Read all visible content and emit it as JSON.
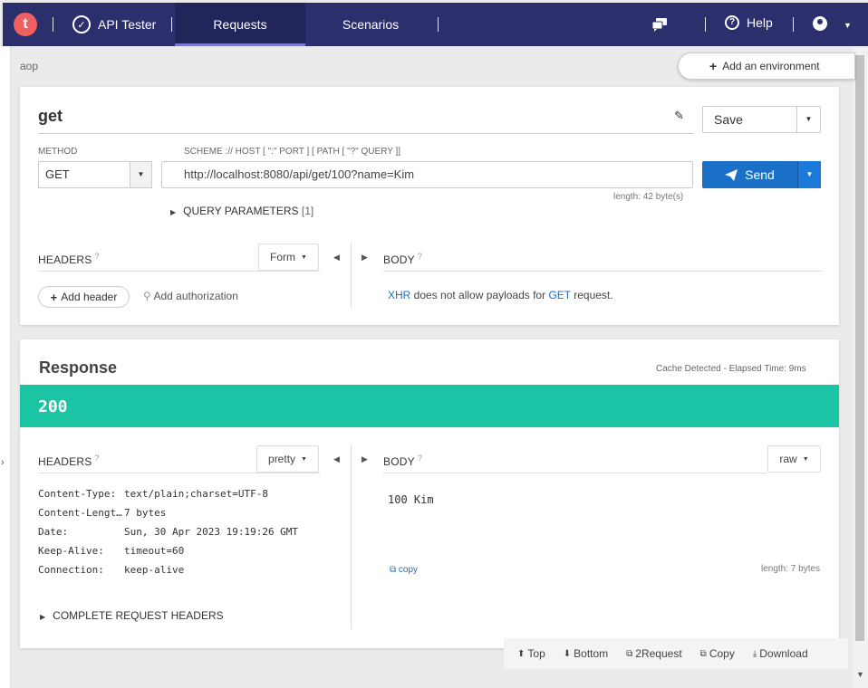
{
  "nav": {
    "logo_letter": "t",
    "brand": "API Tester",
    "tabs": [
      "Requests",
      "Scenarios"
    ],
    "help": "Help"
  },
  "breadcrumb": "aop",
  "env_button": "Add an environment",
  "request": {
    "name": "get",
    "save_label": "Save",
    "method_label": "METHOD",
    "method": "GET",
    "url_label": "SCHEME :// HOST [ \":\" PORT ] [ PATH [ \"?\" QUERY ]]",
    "url": "http://localhost:8080/api/get/100?name=Kim",
    "send_label": "Send",
    "url_length": "length: 42 byte(s)",
    "query_params": "QUERY PARAMETERS",
    "query_params_count": "[1]",
    "headers_label": "HEADERS",
    "form_label": "Form",
    "body_label": "BODY",
    "add_header": "Add header",
    "add_authorization": "Add authorization",
    "body_msg": {
      "xhr": "XHR",
      "middle": " does not allow payloads for ",
      "get": "GET",
      "end": " request."
    }
  },
  "response": {
    "title": "Response",
    "meta": "Cache Detected - Elapsed Time: 9ms",
    "status": "200",
    "headers_label": "HEADERS",
    "pretty_label": "pretty",
    "body_label": "BODY",
    "raw_label": "raw",
    "headers": [
      {
        "key": "Content-Type:",
        "value": "text/plain;charset=UTF-8"
      },
      {
        "key": "Content-Lengt…",
        "value": "7 bytes"
      },
      {
        "key": "Date:",
        "value": "Sun, 30 Apr 2023 19:19:26 GMT"
      },
      {
        "key": "Keep-Alive:",
        "value": "timeout=60"
      },
      {
        "key": "Connection:",
        "value": "keep-alive"
      }
    ],
    "body": "100 Kim",
    "copy": "copy",
    "length": "length: 7 bytes",
    "complete_headers": "COMPLETE REQUEST HEADERS"
  },
  "bottom_bar": [
    "Top",
    "Bottom",
    "2Request",
    "Copy",
    "Download"
  ],
  "colors": {
    "navbar": "#2b2f6b",
    "status_ok": "#1cc4a6",
    "send": "#1a6fc7",
    "logo": "#f06060"
  }
}
